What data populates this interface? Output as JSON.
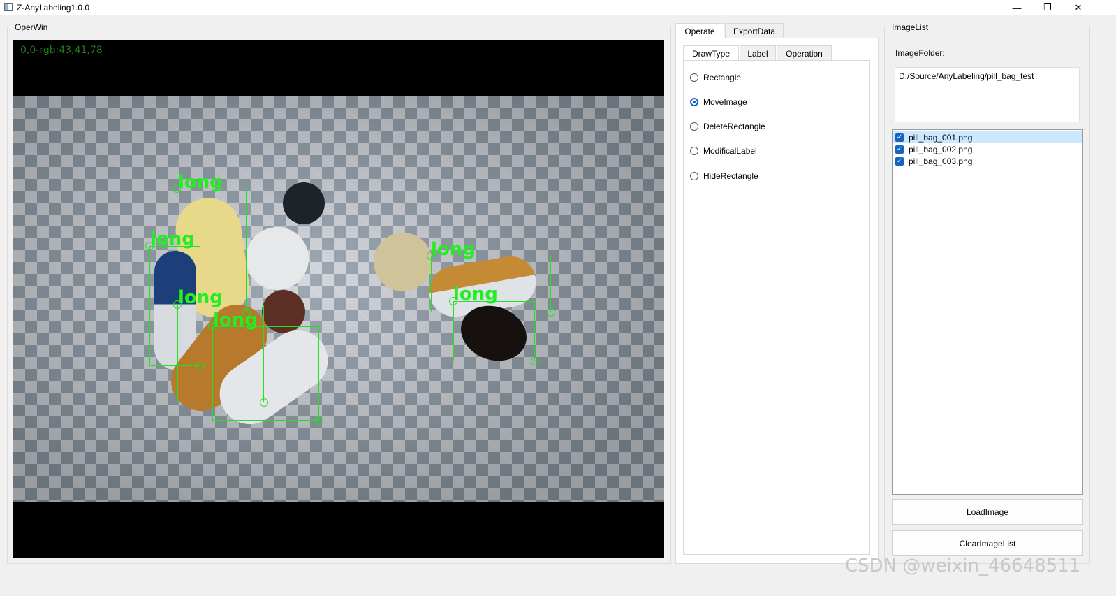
{
  "window": {
    "title": "Z-AnyLabeling1.0.0",
    "minimize": "—",
    "restore": "❐",
    "close": "✕"
  },
  "operwin": {
    "title": "OperWin",
    "coord_readout": "0,0-rgb:43,41,78",
    "boxes": [
      {
        "label": "long"
      },
      {
        "label": "long"
      },
      {
        "label": "long"
      },
      {
        "label": "long"
      },
      {
        "label": "long"
      },
      {
        "label": "long"
      }
    ]
  },
  "tabs": {
    "operate": "Operate",
    "export_data": "ExportData"
  },
  "subtabs": {
    "draw_type": "DrawType",
    "label": "Label",
    "operation": "Operation"
  },
  "draw_types": [
    {
      "label": "Rectangle",
      "checked": false
    },
    {
      "label": "MoveImage",
      "checked": true
    },
    {
      "label": "DeleteRectangle",
      "checked": false
    },
    {
      "label": "ModificalLabel",
      "checked": false
    },
    {
      "label": "HideRectangle",
      "checked": false
    }
  ],
  "image_list": {
    "title": "ImageList",
    "folder_label": "ImageFolder:",
    "folder_path": "D:/Source/AnyLabeling/pill_bag_test",
    "files": [
      {
        "name": "pill_bag_001.png",
        "checked": true,
        "selected": true
      },
      {
        "name": "pill_bag_002.png",
        "checked": true,
        "selected": false
      },
      {
        "name": "pill_bag_003.png",
        "checked": true,
        "selected": false
      }
    ],
    "load_button": "LoadImage",
    "clear_button": "ClearImageList"
  },
  "watermark": "CSDN @weixin_46648511",
  "colors": {
    "box": "#22e022",
    "accent": "#1565c0",
    "selection": "#cce8ff"
  }
}
